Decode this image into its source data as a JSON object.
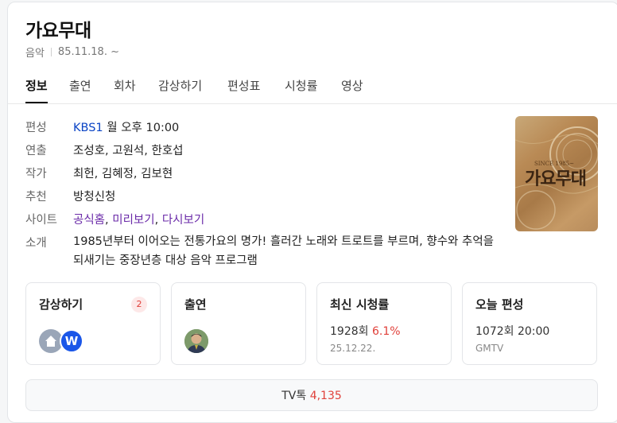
{
  "program": {
    "title": "가요무대",
    "category": "음악",
    "start_date": "85.11.18. ~"
  },
  "tabs": [
    "정보",
    "출연",
    "회차",
    "감상하기",
    "편성표",
    "시청률",
    "영상"
  ],
  "info": {
    "schedule": {
      "key": "편성",
      "channel": "KBS1",
      "time": "월 오후 10:00"
    },
    "director": {
      "key": "연출",
      "value": "조성호, 고원석, 한호섭"
    },
    "writer": {
      "key": "작가",
      "value": "최헌, 김혜정, 김보현"
    },
    "recommend": {
      "key": "추천",
      "value": "방청신청"
    },
    "site": {
      "key": "사이트",
      "links": [
        "공식홈",
        "미리보기",
        "다시보기"
      ]
    },
    "intro": {
      "key": "소개",
      "value": "1985년부터 이어오는 전통가요의 명가! 흘러간 노래와 트로트를 부르며, 향수와 추억을 되새기는 중장년층 대상 음악 프로그램"
    }
  },
  "poster": {
    "tagline": "SINCE 1985~",
    "logo_text": "가요무대"
  },
  "cards": {
    "watch": {
      "title": "감상하기",
      "count": "2",
      "icons": [
        "home-icon",
        "wavve-icon"
      ],
      "wavve_letter": "W"
    },
    "cast": {
      "title": "출연"
    },
    "ratings": {
      "title": "최신 시청률",
      "episode": "1928회",
      "rate": "6.1%",
      "date": "25.12.22."
    },
    "today": {
      "title": "오늘 편성",
      "episode": "1072회",
      "time": "20:00",
      "channel": "GMTV"
    }
  },
  "tvtalk": {
    "label": "TV톡",
    "count": "4,135"
  },
  "colors": {
    "link_blue": "#0b44c5",
    "visited_purple": "#6a2aa8",
    "accent_red": "#e0403a",
    "wavve_blue": "#1a56e8"
  }
}
